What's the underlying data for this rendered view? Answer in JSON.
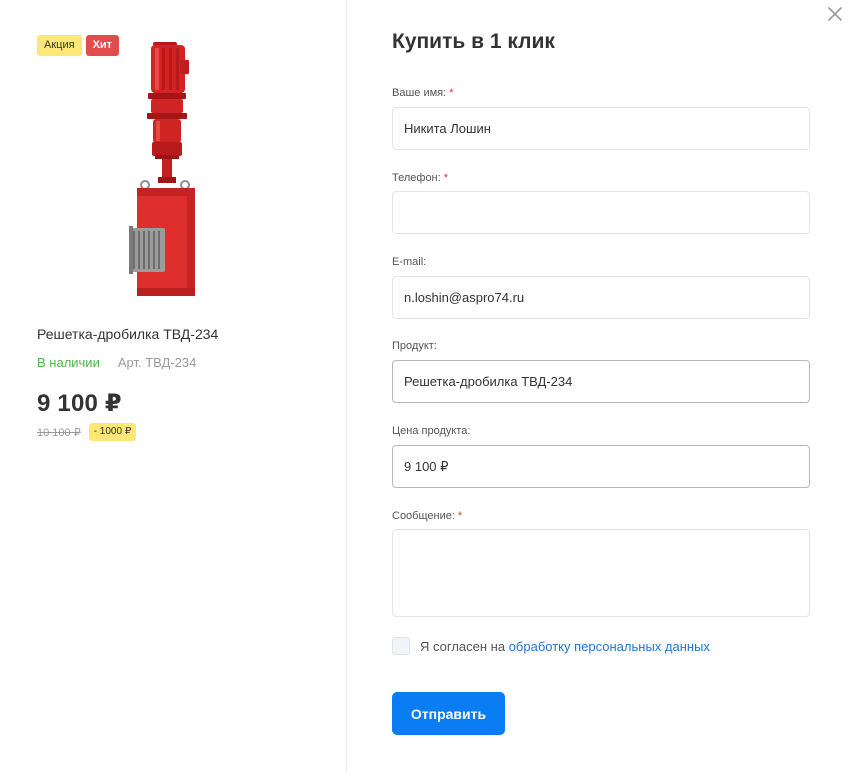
{
  "product": {
    "stickers": {
      "sale": "Акция",
      "hit": "Хит"
    },
    "name": "Решетка-дробилка ТВД-234",
    "stock": "В наличии",
    "article": "Арт. ТВД-234",
    "price": "9 100 ₽",
    "price_old": "10 100 ₽",
    "economy": "- 1000 ₽"
  },
  "form": {
    "title": "Купить в 1 клик",
    "required_mark": "*",
    "name": {
      "label": "Ваше имя:",
      "value": "Никита Лошин"
    },
    "phone": {
      "label": "Телефон:",
      "value": ""
    },
    "email": {
      "label": "E-mail:",
      "value": "n.loshin@aspro74.ru"
    },
    "product": {
      "label": "Продукт:",
      "value": "Решетка-дробилка ТВД-234"
    },
    "price": {
      "label": "Цена продукта:",
      "value": "9 100 ₽"
    },
    "message": {
      "label": "Сообщение:",
      "value": ""
    },
    "agree_text": "Я согласен на",
    "agree_link": "обработку персональных данных",
    "submit_label": "Отправить"
  },
  "colors": {
    "accent": "#0a7cf4",
    "stock": "#4cb848",
    "sticker_sale": "#fde776",
    "sticker_hit": "#e34c4c",
    "required": "#e0342f",
    "link": "#2376d6"
  },
  "icons": {
    "close": "close-icon"
  }
}
